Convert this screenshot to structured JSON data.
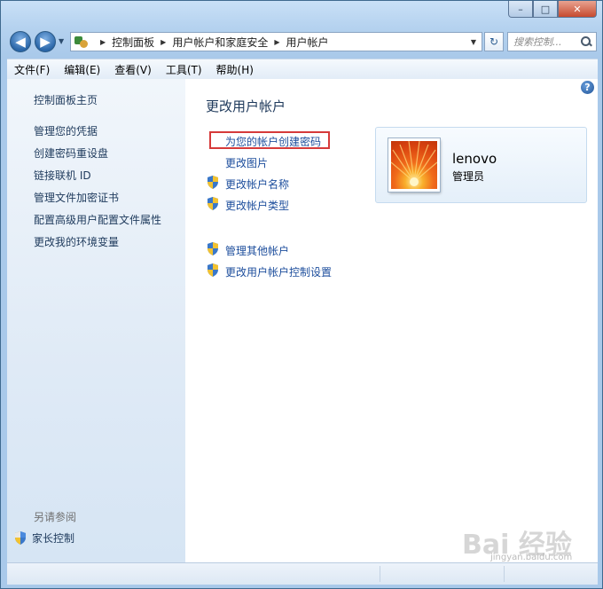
{
  "window": {
    "minimize_label": "–",
    "maximize_label": "□",
    "close_label": "✕"
  },
  "navbar": {
    "back_label": "◀",
    "forward_label": "▶",
    "history_label": "▼",
    "breadcrumb": [
      "控制面板",
      "用户帐户和家庭安全",
      "用户帐户"
    ],
    "breadcrumb_sep": "▶",
    "address_dropdown": "▼",
    "refresh_label": "↻",
    "search_placeholder": "搜索控制..."
  },
  "menu": {
    "items": [
      "文件(F)",
      "编辑(E)",
      "查看(V)",
      "工具(T)",
      "帮助(H)"
    ]
  },
  "sidebar": {
    "home": "控制面板主页",
    "links": [
      "管理您的凭据",
      "创建密码重设盘",
      "链接联机 ID",
      "管理文件加密证书",
      "配置高级用户配置文件属性",
      "更改我的环境变量"
    ],
    "see_also_heading": "另请参阅",
    "parental_controls": "家长控制"
  },
  "main": {
    "title": "更改用户帐户",
    "tasks": [
      "为您的帐户创建密码",
      "更改图片",
      "更改帐户名称",
      "更改帐户类型"
    ],
    "other_tasks": [
      "管理其他帐户",
      "更改用户帐户控制设置"
    ],
    "help_label": "?"
  },
  "user": {
    "name": "lenovo",
    "role": "管理员"
  },
  "watermark": {
    "text": "Bai 经验",
    "sub": "jingyan.baidu.com"
  }
}
